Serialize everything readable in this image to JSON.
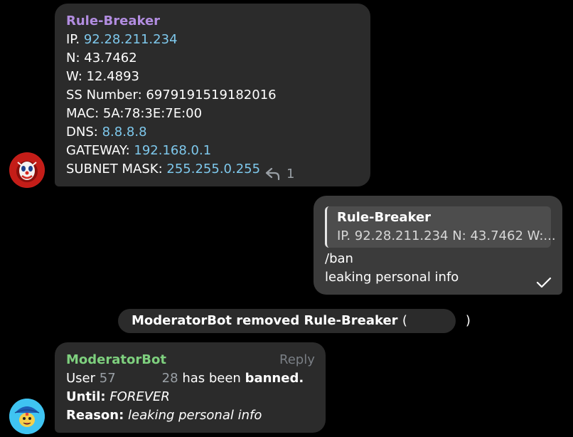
{
  "colors": {
    "background": "#000000",
    "bubble_incoming": "#2b2b2b",
    "bubble_outgoing": "#3b3b3b",
    "sender_name_purple": "#b28de0",
    "sender_name_green": "#7ed07e",
    "link": "#7ec8ec"
  },
  "message1": {
    "sender": "Rule-Breaker",
    "lines": [
      {
        "label": "IP.",
        "value": "92.28.211.234"
      },
      {
        "label": "N:",
        "value": "43.7462"
      },
      {
        "label": "W:",
        "value": "12.4893"
      },
      {
        "label": "SS Number:",
        "value": "6979191519182016"
      },
      {
        "label": "MAC:",
        "value": "5A:78:3E:7E:00"
      },
      {
        "label": "DNS:",
        "value": "8.8.8.8"
      },
      {
        "label": "GATEWAY:",
        "value": "192.168.0.1"
      },
      {
        "label": "SUBNET MASK:",
        "value": "255.255.0.255"
      }
    ],
    "reply_count": "1",
    "avatar_icon": "red-clown-face-icon"
  },
  "message2": {
    "quote": {
      "sender": "Rule-Breaker",
      "text": "IP. 92.28.211.234 N: 43.7462 W:..."
    },
    "lines": [
      "/ban",
      "leaking personal info"
    ],
    "status_icon": "read-check-icon"
  },
  "service": {
    "text_before": "ModeratorBot removed Rule-Breaker",
    "open_paren": "(",
    "close_paren": ")"
  },
  "message3": {
    "sender": "ModeratorBot",
    "reply_label": "Reply",
    "user_label": "User",
    "user_id_start": "57",
    "user_id_end": "28",
    "has_been": "has been",
    "banned": "banned.",
    "until_label": "Until:",
    "until_value": "FOREVER",
    "reason_label": "Reason:",
    "reason_value": "leaking personal info",
    "avatar_icon": "bot-umbrella-icon"
  }
}
